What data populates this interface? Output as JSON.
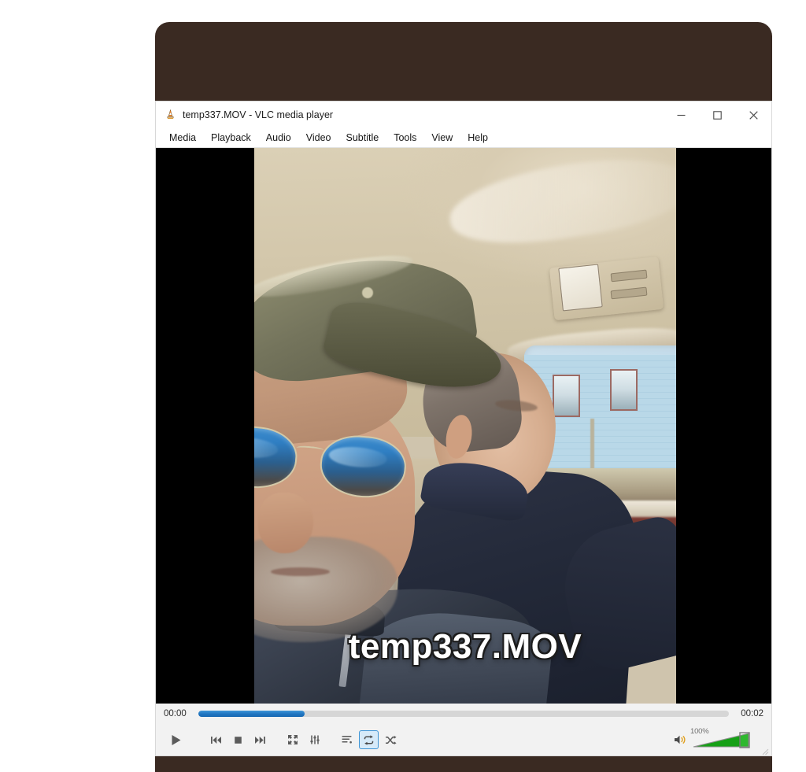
{
  "window": {
    "title": "temp337.MOV - VLC media player",
    "app_icon": "vlc-cone-icon",
    "minimize_label": "Minimize",
    "maximize_label": "Maximize",
    "close_label": "Close"
  },
  "menubar": {
    "items": [
      {
        "label": "Media"
      },
      {
        "label": "Playback"
      },
      {
        "label": "Audio"
      },
      {
        "label": "Video"
      },
      {
        "label": "Subtitle"
      },
      {
        "label": "Tools"
      },
      {
        "label": "View"
      },
      {
        "label": "Help"
      }
    ]
  },
  "video": {
    "osd_filename": "temp337.MOV",
    "scene_description": "Two men inside a car; foreground man wearing an olive cap and blue mirrored aviator sunglasses, passenger with gray hair in a navy jacket, light blue house visible through the side window",
    "letterbox_color": "#000000"
  },
  "seek": {
    "elapsed": "00:00",
    "duration": "00:02",
    "progress_percent": 20,
    "fill_color": "#1f74c0",
    "track_color": "#d6d6d6"
  },
  "controls": {
    "play": "Play",
    "previous": "Previous",
    "stop": "Stop",
    "next": "Next",
    "fullscreen": "Toggle fullscreen",
    "extended_settings": "Show extended settings",
    "playlist": "Show playlist",
    "loop": "Loop",
    "random": "Random",
    "loop_active": true
  },
  "volume": {
    "level_label": "100%",
    "level_percent": 100,
    "mute_icon": "speaker-icon",
    "slider_color": "#2eb82e"
  },
  "colors": {
    "backdrop": "#3a2a22",
    "page_background": "#ffffff",
    "chrome": "#f2f2f2",
    "accent": "#1f74c0"
  }
}
